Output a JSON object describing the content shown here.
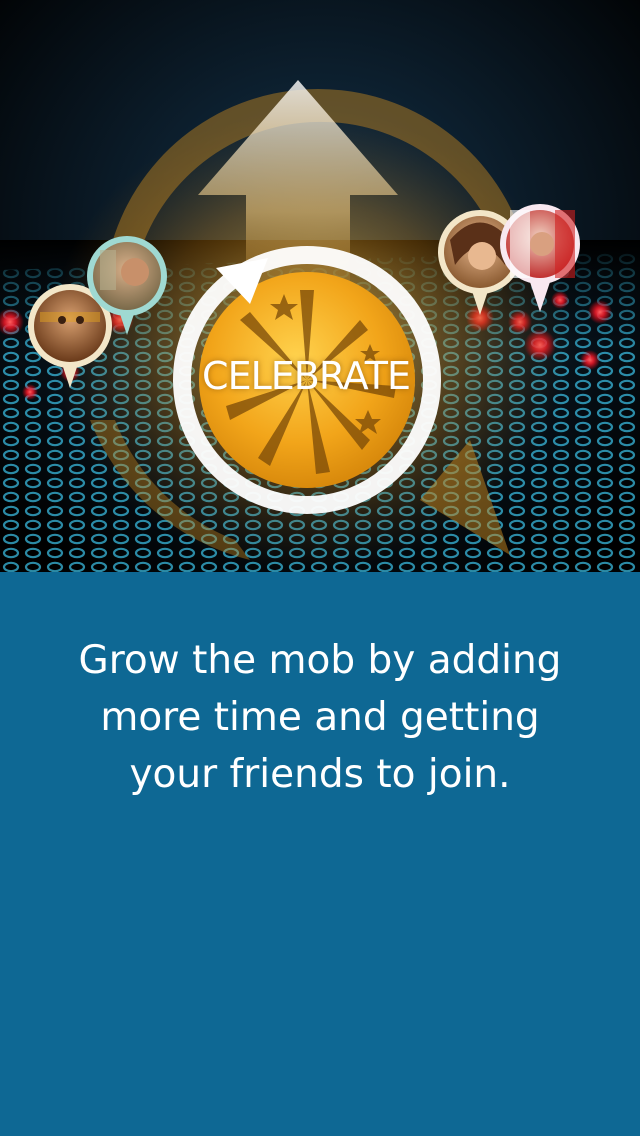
{
  "hero": {
    "celebrate_label": "CELEBRATE"
  },
  "tagline": {
    "lines": [
      "Grow the mob by adding",
      "more time and getting",
      "your friends to join."
    ]
  },
  "colors": {
    "panel_background": "#0e6894",
    "accent_gold": "#f2b21c",
    "map_dot_red": "#ff2030",
    "map_dot_blue": "#2fa3c8"
  },
  "icons": [
    "refresh-arrow-icon",
    "arrow-up-icon",
    "fireworks-icon",
    "map-pin-icon"
  ]
}
